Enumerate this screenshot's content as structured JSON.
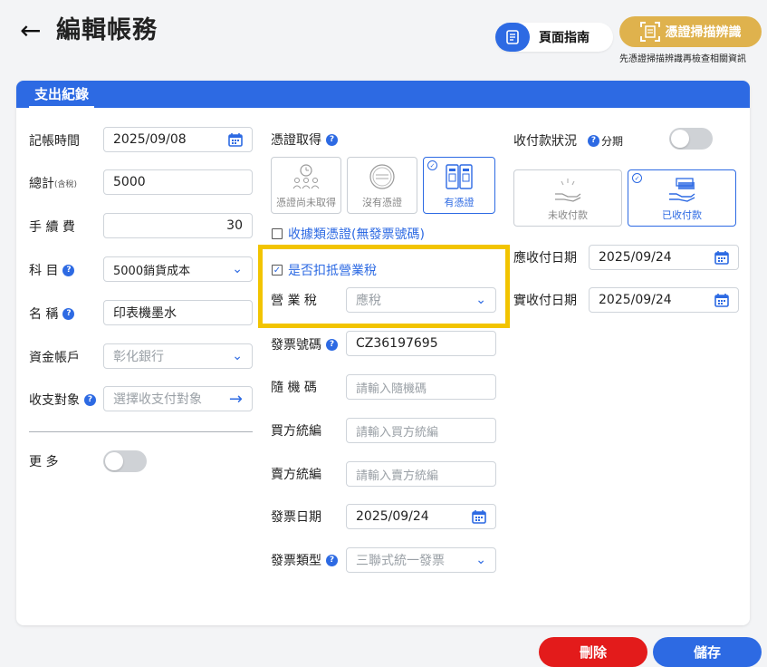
{
  "header": {
    "title": "編輯帳務",
    "guide_label": "頁面指南",
    "scan_label": "憑證掃描辨識",
    "scan_hint": "先憑證掃描辨識再檢查相關資訊"
  },
  "section_tab": "支出紀錄",
  "left": {
    "date_label": "記帳時間",
    "date_value": "2025/09/08",
    "total_label": "總計",
    "total_note": "(含稅)",
    "total_value": "5000",
    "fee_label": "手 續 費",
    "fee_value": "30",
    "subject_label": "科 目",
    "subject_value": "5000銷貨成本",
    "name_label": "名 稱",
    "name_value": "印表機墨水",
    "account_label": "資金帳戶",
    "account_value": "彰化銀行",
    "party_label": "收支對象",
    "party_placeholder": "選擇收支付對象",
    "more_label": "更 多"
  },
  "middle": {
    "voucher_label": "憑證取得",
    "options": [
      "憑證尚未取得",
      "沒有憑證",
      "有憑證"
    ],
    "receipt_checkbox": "收據類憑證(無發票號碼)",
    "deduct_checkbox": "是否扣抵營業稅",
    "tax_label": "營 業 稅",
    "tax_value": "應稅",
    "invoice_no_label": "發票號碼",
    "invoice_no_value": "CZ36197695",
    "random_label": "隨 機 碼",
    "random_placeholder": "請輸入隨機碼",
    "buyer_label": "買方統編",
    "buyer_placeholder": "請輸入買方統編",
    "seller_label": "賣方統編",
    "seller_placeholder": "請輸入賣方統編",
    "invoice_date_label": "發票日期",
    "invoice_date_value": "2025/09/24",
    "invoice_type_label": "發票類型",
    "invoice_type_value": "三聯式統一發票"
  },
  "right": {
    "status_label": "收付款狀況",
    "installment_label": "分期",
    "options": [
      "未收付款",
      "已收付款"
    ],
    "due_date_label": "應收付日期",
    "due_date_value": "2025/09/24",
    "actual_date_label": "實收付日期",
    "actual_date_value": "2025/09/24"
  },
  "actions": {
    "delete_label": "刪除",
    "save_label": "儲存"
  },
  "colors": {
    "primary": "#2d6ae3",
    "danger": "#e31b1b",
    "scan": "#dfb24d",
    "highlight": "#f2c400"
  }
}
